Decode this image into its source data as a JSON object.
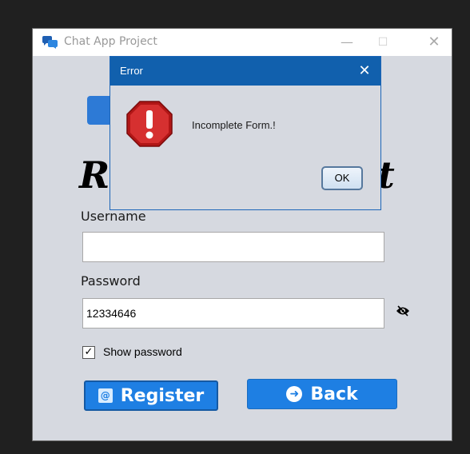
{
  "window": {
    "title": "Chat App Project",
    "icon": "chat-bubbles-icon",
    "controls": {
      "minimize": "—",
      "maximize": "☐",
      "close": "✕"
    }
  },
  "form": {
    "heading_left": "Re",
    "heading_right": "t",
    "username_label": "Username",
    "username_value": "",
    "password_label": "Password",
    "password_value": "12334646",
    "show_password_label": "Show password",
    "show_password_checked": true,
    "show_password_mark": "✓",
    "register_label": "Register",
    "register_icon_glyph": "@",
    "back_label": "Back",
    "back_icon_glyph": "➜"
  },
  "dialog": {
    "title": "Error",
    "close_glyph": "✕",
    "message": "Incomplete Form.!",
    "ok_label": "OK",
    "icon": "error-stop-icon"
  },
  "colors": {
    "accent": "#1e7fe3",
    "dialog_title_bg": "#1160ad",
    "window_bg": "#d6d9e0",
    "error_red": "#c71d1d"
  }
}
